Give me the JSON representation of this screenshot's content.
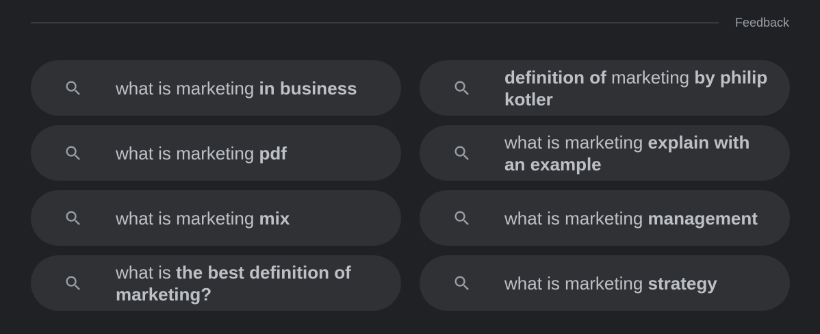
{
  "feedback_label": "Feedback",
  "suggestions": [
    {
      "normal_1": "what is marketing ",
      "bold_1": "in business",
      "normal_2": "",
      "bold_2": ""
    },
    {
      "normal_1": "",
      "bold_1": "definition of",
      "normal_2": " marketing ",
      "bold_2": "by philip kotler"
    },
    {
      "normal_1": "what is marketing ",
      "bold_1": "pdf",
      "normal_2": "",
      "bold_2": ""
    },
    {
      "normal_1": "what is marketing ",
      "bold_1": "explain with an example",
      "normal_2": "",
      "bold_2": ""
    },
    {
      "normal_1": "what is marketing ",
      "bold_1": "mix",
      "normal_2": "",
      "bold_2": ""
    },
    {
      "normal_1": "what is marketing ",
      "bold_1": "management",
      "normal_2": "",
      "bold_2": ""
    },
    {
      "normal_1": "what is ",
      "bold_1": "the best definition of marketing?",
      "normal_2": "",
      "bold_2": ""
    },
    {
      "normal_1": "what is marketing ",
      "bold_1": "strategy",
      "normal_2": "",
      "bold_2": ""
    }
  ]
}
